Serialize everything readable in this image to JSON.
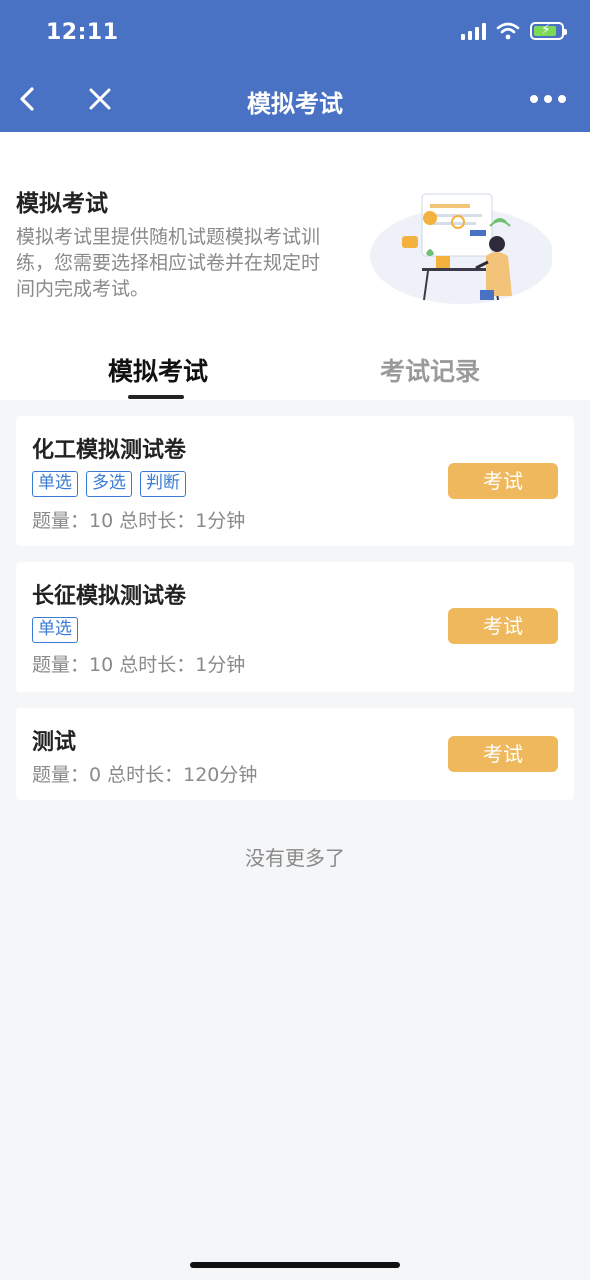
{
  "status_bar": {
    "time": "12:11"
  },
  "nav": {
    "title": "模拟考试"
  },
  "intro": {
    "title": "模拟考试",
    "description": "模拟考试里提供随机试题模拟考试训练，您需要选择相应试卷并在规定时间内完成考试。"
  },
  "tabs": [
    {
      "label": "模拟考试",
      "active": true
    },
    {
      "label": "考试记录",
      "active": false
    }
  ],
  "exams": [
    {
      "title": "化工模拟测试卷",
      "tags": [
        "单选",
        "多选",
        "判断"
      ],
      "meta": "题量：10 总时长：1分钟",
      "button": "考试"
    },
    {
      "title": "长征模拟测试卷",
      "tags": [
        "单选"
      ],
      "meta": "题量：10 总时长：1分钟",
      "button": "考试"
    },
    {
      "title": "测试",
      "tags": [],
      "meta": "题量：0 总时长：120分钟",
      "button": "考试"
    }
  ],
  "end_text": "没有更多了",
  "colors": {
    "header": "#4a72c4",
    "button": "#efb85c",
    "tag": "#3a7bd5"
  },
  "icons": [
    "back-icon",
    "close-icon",
    "more-icon",
    "signal-icon",
    "wifi-icon",
    "battery-icon"
  ]
}
